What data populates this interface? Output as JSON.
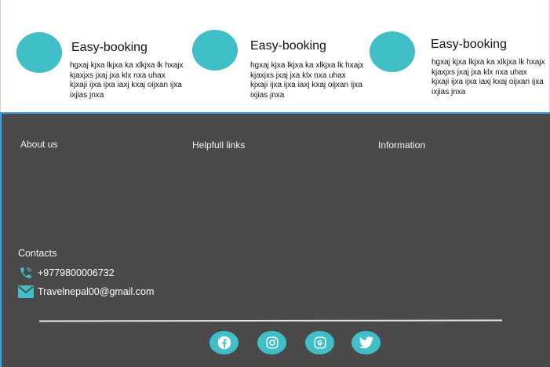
{
  "features": [
    {
      "title": "Easy-booking",
      "text": "hgxaj kjxa lkjxa ka xlkjxa lk hxajx kjaxjxs jxaj jxa klx nxa uhax kjxaji ijxa ijxa iaxj kxaj oijxan ijxa  ixjias  jnxa"
    },
    {
      "title": "Easy-booking",
      "text": "hgxaj kjxa lkjxa ka xlkjxa lk hxajx kjaxjxs jxaj jxa klx nxa uhax kjxaji ijxa ijxa iaxj kxaj oijxan ijxa  ixjias  jnxa"
    },
    {
      "title": "Easy-booking",
      "text": "hgxaj kjxa lkjxa ka xlkjxa lk hxajx kjaxjxs jxaj jxa klx nxa uhax kjxaji ijxa ijxa iaxj kxaj oijxan ijxa  ixjias  jnxa"
    }
  ],
  "footer": {
    "about": "About us",
    "links": "Helpfull links",
    "info": "Information",
    "contacts_title": "Contacts",
    "phone": "+9779800006732",
    "email": "Travelnepal00@gmail.com"
  },
  "social": [
    "facebook-icon",
    "instagram-icon",
    "google-icon",
    "twitter-icon"
  ],
  "colors": {
    "accent": "#41bfc8",
    "footer_bg": "#4a4a4a",
    "footer_border": "#3aa3e8"
  }
}
